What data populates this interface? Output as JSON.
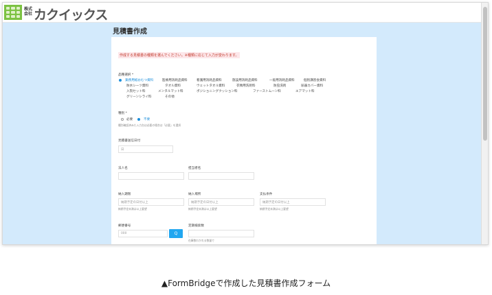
{
  "header": {
    "logo_small": "株式会社",
    "logo_name": "カクイックス"
  },
  "page": {
    "title": "見積書作成"
  },
  "form": {
    "notice": "作成する見積書の種類を選んでください。※種類に応じて入力が変わります。",
    "item_label": "品種選択 *",
    "items": [
      {
        "label": "業務用紙おむつ資料",
        "selected": true
      },
      {
        "label": "医療用消耗品資料",
        "selected": false
      },
      {
        "label": "看護用消耗品資料",
        "selected": false
      },
      {
        "label": "施設用消耗品資料",
        "selected": false
      },
      {
        "label": "一般用消耗品資料",
        "selected": false
      },
      {
        "label": "個別講習会資料",
        "selected": false
      },
      {
        "label": "防水シーツ資料",
        "selected": false
      },
      {
        "label": "タオル資料",
        "selected": false
      },
      {
        "label": "ウェットタオル資料",
        "selected": false
      },
      {
        "label": "衣類用洗剤料",
        "selected": false
      },
      {
        "label": "防虫洗剤",
        "selected": false
      },
      {
        "label": "尿器カバー資料",
        "selected": false
      },
      {
        "label": "入院セット料",
        "selected": false
      },
      {
        "label": "メンタルマット料",
        "selected": false
      },
      {
        "label": "ポジショニングクッション料",
        "selected": false
      },
      {
        "label": "ファーストムーン料",
        "selected": false
      },
      {
        "label": "エアマット料",
        "selected": false
      },
      {
        "label": "グリーンシライ料",
        "selected": false
      },
      {
        "label": "その他",
        "selected": false
      }
    ],
    "need_label": "種別 *",
    "need_options": [
      {
        "label": "必要",
        "selected": false
      },
      {
        "label": "不要",
        "selected": true
      }
    ],
    "need_hint": "種別確認済みた入力台は必要の場合は「必要」を選択",
    "date_label": "見積書送信日付",
    "date_placeholder": "日",
    "name_label": "法人名",
    "person_label": "担当者名",
    "qty1_label": "納入期限",
    "qty1_placeholder": "納期予定の日付以上",
    "qty1_hint": "納期予定未満は以上要望",
    "qty2_label": "納入場所",
    "qty2_placeholder": "納期予定の日付以上",
    "qty2_hint": "納期予定未満は以上要望",
    "qty3_label": "支払条件",
    "qty3_placeholder": "納期予定の日付以上",
    "qty3_hint": "納期予定未満は以上要望",
    "zip_label": "郵便番号",
    "zip_placeholder": "000",
    "zip_button": "Q",
    "remarks_label": "定期検索数",
    "remarks_hint": "在庫数わかれる数量で"
  },
  "caption": "▲FormBridgeで作成した見積書作成フォーム",
  "colors": {
    "background": "#d3eafc",
    "accent": "#22a7f0",
    "logo_green": "#7cc242",
    "notice_red": "#c0392b"
  }
}
